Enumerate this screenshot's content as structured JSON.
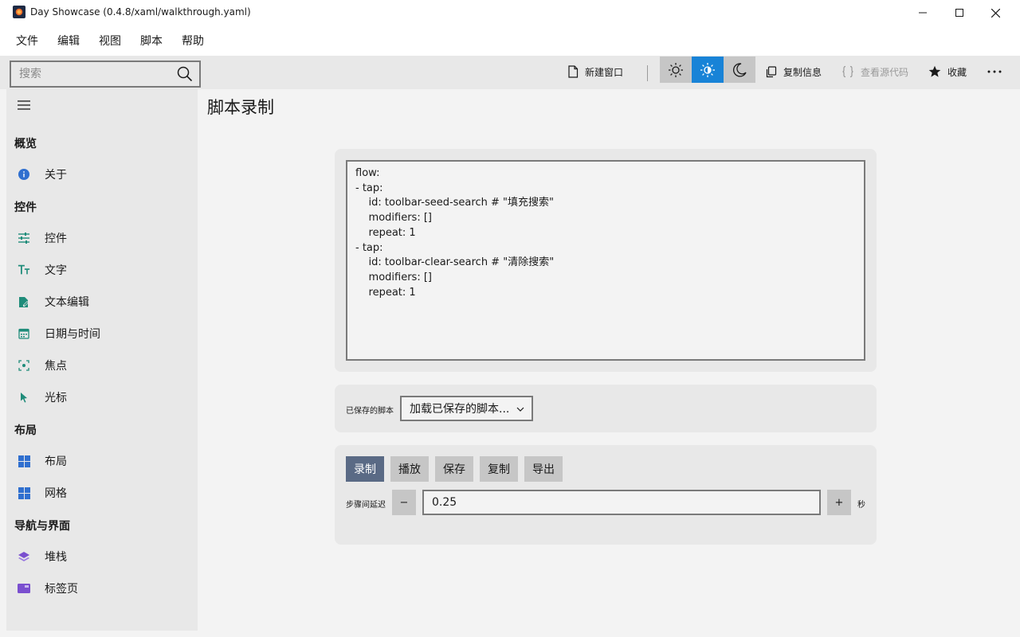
{
  "window": {
    "title": "Day Showcase (0.4.8/xaml/walkthrough.yaml)"
  },
  "menu": [
    "文件",
    "编辑",
    "视图",
    "脚本",
    "帮助"
  ],
  "toolbar": {
    "search_placeholder": "搜索",
    "new_window": "新建窗口",
    "copy_info": "复制信息",
    "view_source": "查看源代码",
    "favorite": "收藏",
    "theme_selected": "auto"
  },
  "sidebar": {
    "sections": [
      {
        "header": "概览",
        "items": [
          {
            "label": "关于",
            "icon": "info-icon"
          }
        ]
      },
      {
        "header": "控件",
        "items": [
          {
            "label": "控件",
            "icon": "sliders-icon"
          },
          {
            "label": "文字",
            "icon": "text-size-icon"
          },
          {
            "label": "文本编辑",
            "icon": "edit-document-icon"
          },
          {
            "label": "日期与时间",
            "icon": "calendar-icon"
          },
          {
            "label": "焦点",
            "icon": "focus-icon"
          },
          {
            "label": "光标",
            "icon": "cursor-icon"
          }
        ]
      },
      {
        "header": "布局",
        "items": [
          {
            "label": "布局",
            "icon": "layout-grid-icon"
          },
          {
            "label": "网格",
            "icon": "grid-icon"
          }
        ]
      },
      {
        "header": "导航与界面",
        "items": [
          {
            "label": "堆栈",
            "icon": "stack-icon"
          },
          {
            "label": "标签页",
            "icon": "tab-icon"
          }
        ]
      }
    ]
  },
  "main": {
    "title": "脚本录制",
    "script": "flow:\n- tap:\n    id: toolbar-seed-search # \"填充搜索\"\n    modifiers: []\n    repeat: 1\n- tap:\n    id: toolbar-clear-search # \"清除搜索\"\n    modifiers: []\n    repeat: 1",
    "saved_label": "已保存的脚本",
    "saved_select_value": "加载已保存的脚本...",
    "actions": {
      "record": "录制",
      "play": "播放",
      "save": "保存",
      "copy": "复制",
      "export": "导出"
    },
    "delay_label": "步骤间延迟",
    "delay_minus": "−",
    "delay_plus": "+",
    "delay_value": "0.25",
    "delay_unit": "秒"
  },
  "colors": {
    "accent": "#1883d7",
    "record_button": "#5a6a85",
    "nav_icon_teal": "#1f8c7a",
    "nav_icon_blue": "#2f6fcf",
    "nav_icon_purple": "#7a4fcf"
  }
}
